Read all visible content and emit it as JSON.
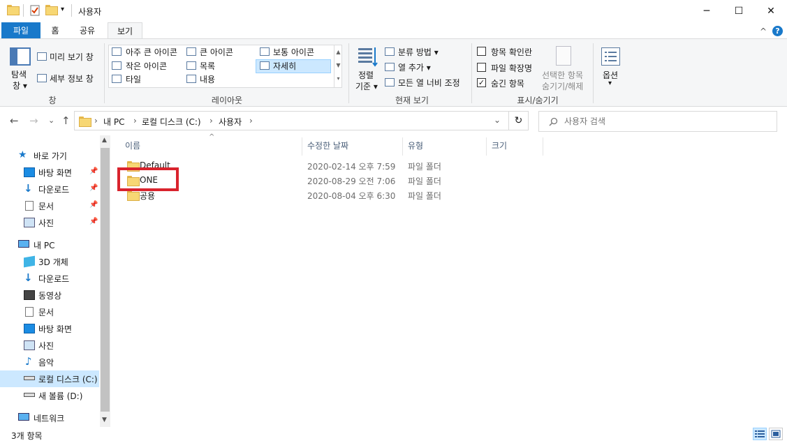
{
  "window": {
    "title": "사용자",
    "minimize_glyph": "─",
    "maximize_glyph": "☐",
    "close_glyph": "✕"
  },
  "ribbon_tabs": [
    {
      "label": "파일"
    },
    {
      "label": "홈"
    },
    {
      "label": "공유"
    },
    {
      "label": "보기"
    }
  ],
  "ribbon_right": {
    "collapse_glyph": "^",
    "help_glyph": "?"
  },
  "ribbon": {
    "pane_group": {
      "nav_pane_label_line1": "탐색",
      "nav_pane_label_line2": "창 ▾",
      "preview_pane": "미리 보기 창",
      "details_pane": "세부 정보 창",
      "group_label": "창"
    },
    "layout_group": {
      "items": [
        "아주 큰 아이콘",
        "큰 아이콘",
        "보통 아이콘",
        "작은 아이콘",
        "목록",
        "자세히",
        "타일",
        "내용"
      ],
      "selected": "자세히",
      "group_label": "레이아웃"
    },
    "current_view_group": {
      "sort_line1": "정렬",
      "sort_line2": "기준 ▾",
      "group_by": "분류 방법 ▾",
      "add_columns": "열 추가 ▾",
      "size_all_columns": "모든 열 너비 조정",
      "group_label": "현재 보기"
    },
    "show_hide_group": {
      "item_checkboxes": {
        "label": "항목 확인란",
        "checked": false
      },
      "file_extensions": {
        "label": "파일 확장명",
        "checked": false
      },
      "hidden_items": {
        "label": "숨긴 항목",
        "checked": true
      },
      "hide_selected_line1": "선택한 항목",
      "hide_selected_line2": "숨기기/해제",
      "group_label": "표시/숨기기"
    },
    "options_group": {
      "label": "옵션",
      "arrow": "▾"
    }
  },
  "address": {
    "back": "←",
    "forward": "→",
    "recent": "⌄",
    "up": "↑",
    "breadcrumb": [
      "내 PC",
      "로컬 디스크 (C:)",
      "사용자"
    ],
    "separator": "›",
    "dropdown": "⌄",
    "refresh": "↻"
  },
  "search": {
    "placeholder": "사용자 검색"
  },
  "nav_pane": {
    "items": [
      {
        "label": "바로 가기",
        "pinned": false
      },
      {
        "label": "바탕 화면",
        "pinned": true
      },
      {
        "label": "다운로드",
        "pinned": true
      },
      {
        "label": "문서",
        "pinned": true
      },
      {
        "label": "사진",
        "pinned": true
      },
      {
        "label": "내 PC",
        "pinned": false
      },
      {
        "label": "3D 개체",
        "pinned": false
      },
      {
        "label": "다운로드",
        "pinned": false
      },
      {
        "label": "동영상",
        "pinned": false
      },
      {
        "label": "문서",
        "pinned": false
      },
      {
        "label": "바탕 화면",
        "pinned": false
      },
      {
        "label": "사진",
        "pinned": false
      },
      {
        "label": "음악",
        "pinned": false
      },
      {
        "label": "로컬 디스크 (C:)",
        "pinned": false,
        "selected": true
      },
      {
        "label": "새 볼륨 (D:)",
        "pinned": false
      },
      {
        "label": "네트워크",
        "pinned": false
      }
    ]
  },
  "columns": {
    "name": "이름",
    "modified": "수정한 날짜",
    "type": "유형",
    "size": "크기",
    "sort_indicator": "^"
  },
  "files": [
    {
      "name": "Default",
      "modified": "2020-02-14 오후 7:59",
      "type": "파일 폴더"
    },
    {
      "name": "ONE",
      "modified": "2020-08-29 오전 7:06",
      "type": "파일 폴더"
    },
    {
      "name": "공용",
      "modified": "2020-08-04 오후 6:30",
      "type": "파일 폴더"
    }
  ],
  "status": {
    "item_count": "3개 항목"
  },
  "colors": {
    "accent": "#1979ca",
    "highlight_box": "#d9232d",
    "selection_bg": "#cce8ff"
  }
}
